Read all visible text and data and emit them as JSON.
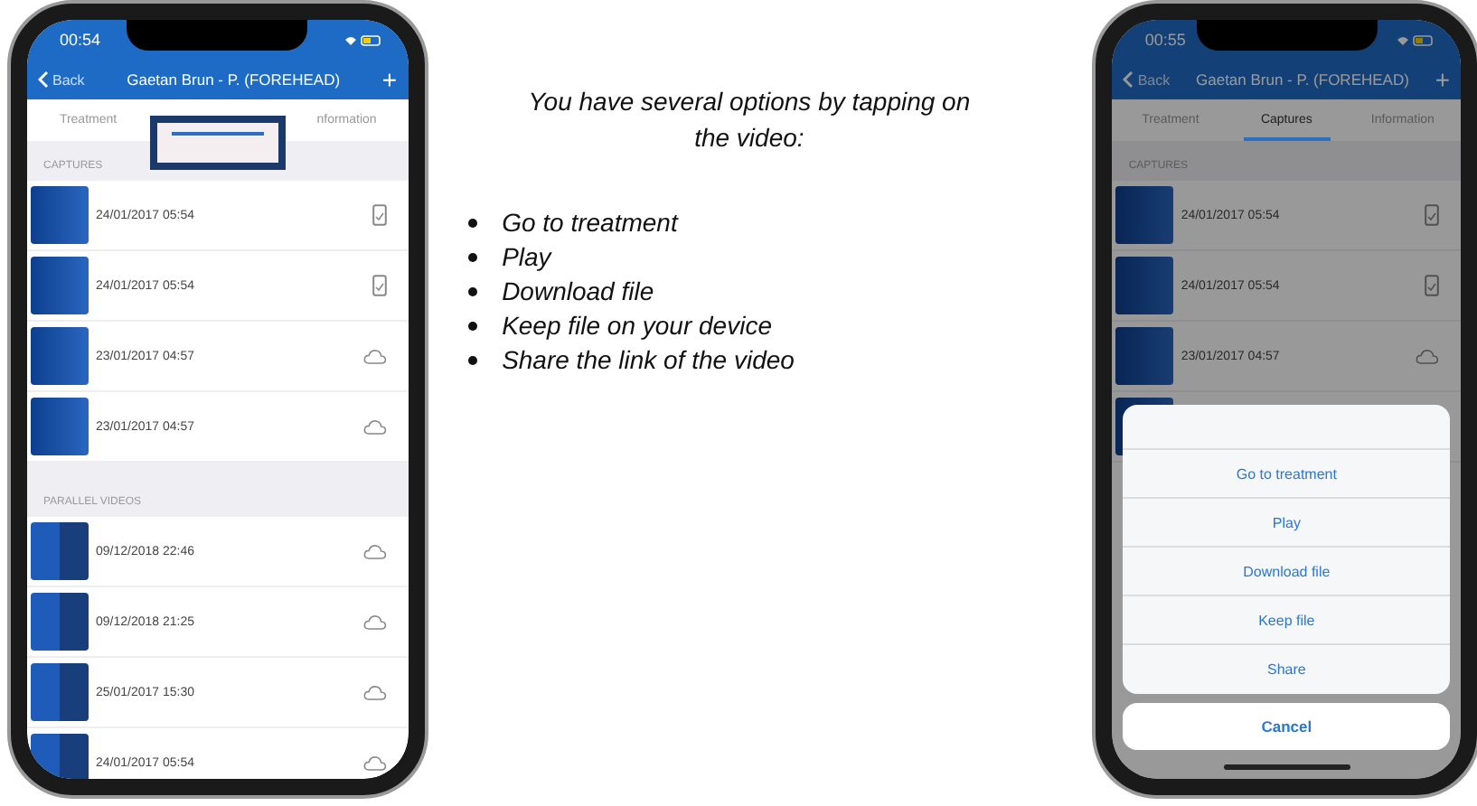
{
  "phones": [
    {
      "time": "00:54",
      "back": "Back",
      "title": "Gaetan Brun - P. (FOREHEAD)",
      "add": "+",
      "tabs": [
        {
          "label": "Treatment",
          "selected": false,
          "highlighted": false
        },
        {
          "selected": true,
          "highlighted": true
        },
        {
          "label": "nformation",
          "selected": false,
          "highlighted": false
        }
      ],
      "sections": [
        {
          "header": "CAPTURES",
          "rows": [
            {
              "kind": "capture",
              "date": "24/01/2017 05:54",
              "on_device": true
            },
            {
              "kind": "capture",
              "date": "24/01/2017 05:54",
              "on_device": true
            },
            {
              "kind": "capture",
              "date": "23/01/2017 04:57",
              "on_device": false
            },
            {
              "kind": "capture",
              "date": "23/01/2017 04:57",
              "on_device": false
            }
          ]
        },
        {
          "header": "PARALLEL VIDEOS",
          "rows": [
            {
              "kind": "parallel",
              "date": "09/12/2018 22:46",
              "on_device": false
            },
            {
              "kind": "parallel",
              "date": "09/12/2018 21:25",
              "on_device": false
            },
            {
              "kind": "parallel",
              "date": "25/01/2017 15:30",
              "on_device": false
            },
            {
              "kind": "parallel",
              "date": "24/01/2017 05:54",
              "on_device": false
            }
          ]
        }
      ]
    },
    {
      "time": "00:55",
      "back": "Back",
      "title": "Gaetan Brun - P. (FOREHEAD)",
      "add": "+",
      "tabs": [
        {
          "label": "Treatment",
          "selected": false,
          "highlighted": false
        },
        {
          "label": "Captures",
          "selected": true,
          "highlighted": false
        },
        {
          "label": "Information",
          "selected": false,
          "highlighted": false
        }
      ],
      "sections": [
        {
          "header": "CAPTURES",
          "rows": [
            {
              "kind": "capture",
              "date": "24/01/2017 05:54",
              "on_device": true
            },
            {
              "kind": "capture",
              "date": "24/01/2017 05:54",
              "on_device": true
            },
            {
              "kind": "capture",
              "date": "23/01/2017 04:57",
              "on_device": false
            },
            {
              "kind": "capture"
            }
          ]
        }
      ],
      "action_sheet": {
        "actions": [
          "Go to treatment",
          "Play",
          "Download file",
          "Keep file",
          "Share"
        ],
        "cancel": "Cancel"
      }
    }
  ],
  "intro": "You have several options by tapping on the video:",
  "options": [
    "Go to treatment",
    "Play",
    "Download file",
    "Keep file on your device",
    "Share the link of the video"
  ]
}
